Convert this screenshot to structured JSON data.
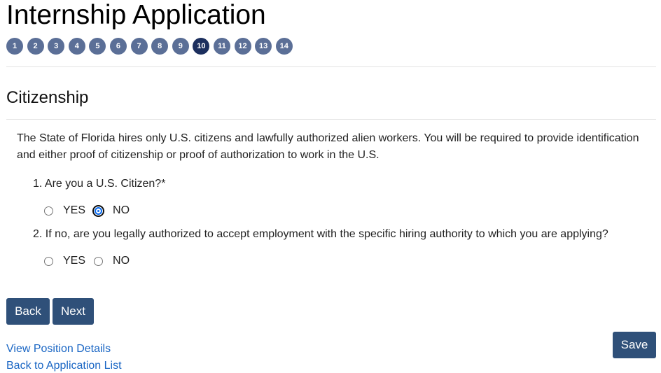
{
  "header": {
    "title": "Internship Application",
    "steps": [
      "1",
      "2",
      "3",
      "4",
      "5",
      "6",
      "7",
      "8",
      "9",
      "10",
      "11",
      "12",
      "13",
      "14"
    ],
    "current_step": "10"
  },
  "section": {
    "title": "Citizenship",
    "intro": "The State of Florida hires only U.S. citizens and lawfully authorized alien workers. You will be required to provide identification and either proof of citizenship or proof of authorization to work in the U.S."
  },
  "questions": [
    {
      "label": "1. Are you a U.S. Citizen?*",
      "options": [
        "YES",
        "NO"
      ],
      "selected": "NO"
    },
    {
      "label": "2. If no, are you legally authorized to accept employment with the specific hiring authority to which you are applying?",
      "options": [
        "YES",
        "NO"
      ],
      "selected": null
    }
  ],
  "buttons": {
    "back": "Back",
    "next": "Next",
    "save": "Save"
  },
  "links": {
    "view_position": "View Position Details",
    "back_to_list": "Back to Application List"
  },
  "colors": {
    "step": "#5b6f97",
    "step_active": "#1c2f5e",
    "button": "#2f5079",
    "link": "#1a66c4"
  }
}
